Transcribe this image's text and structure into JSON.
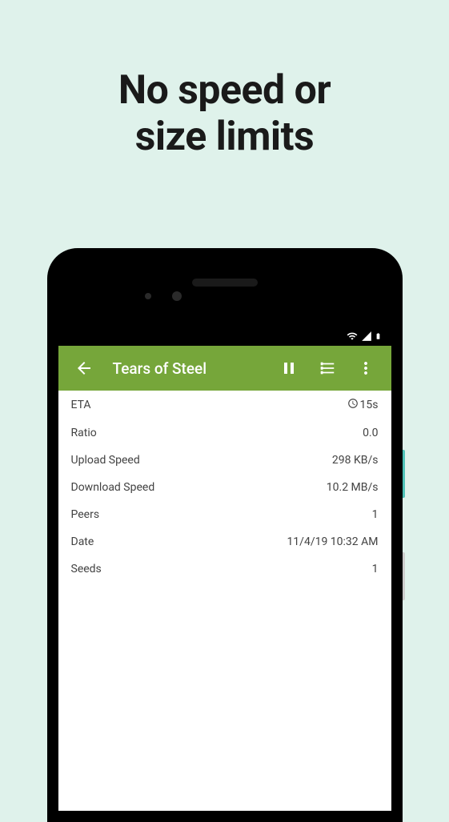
{
  "headline": {
    "line1": "No speed or",
    "line2": "size limits"
  },
  "appBar": {
    "title": "Tears of Steel"
  },
  "rows": [
    {
      "label": "ETA",
      "value": "15s",
      "hasClock": true
    },
    {
      "label": "Ratio",
      "value": "0.0",
      "hasClock": false
    },
    {
      "label": "Upload Speed",
      "value": "298 KB/s",
      "hasClock": false
    },
    {
      "label": "Download Speed",
      "value": "10.2 MB/s",
      "hasClock": false
    },
    {
      "label": "Peers",
      "value": "1",
      "hasClock": false
    },
    {
      "label": "Date",
      "value": "11/4/19 10:32 AM",
      "hasClock": false
    },
    {
      "label": "Seeds",
      "value": "1",
      "hasClock": false
    }
  ]
}
